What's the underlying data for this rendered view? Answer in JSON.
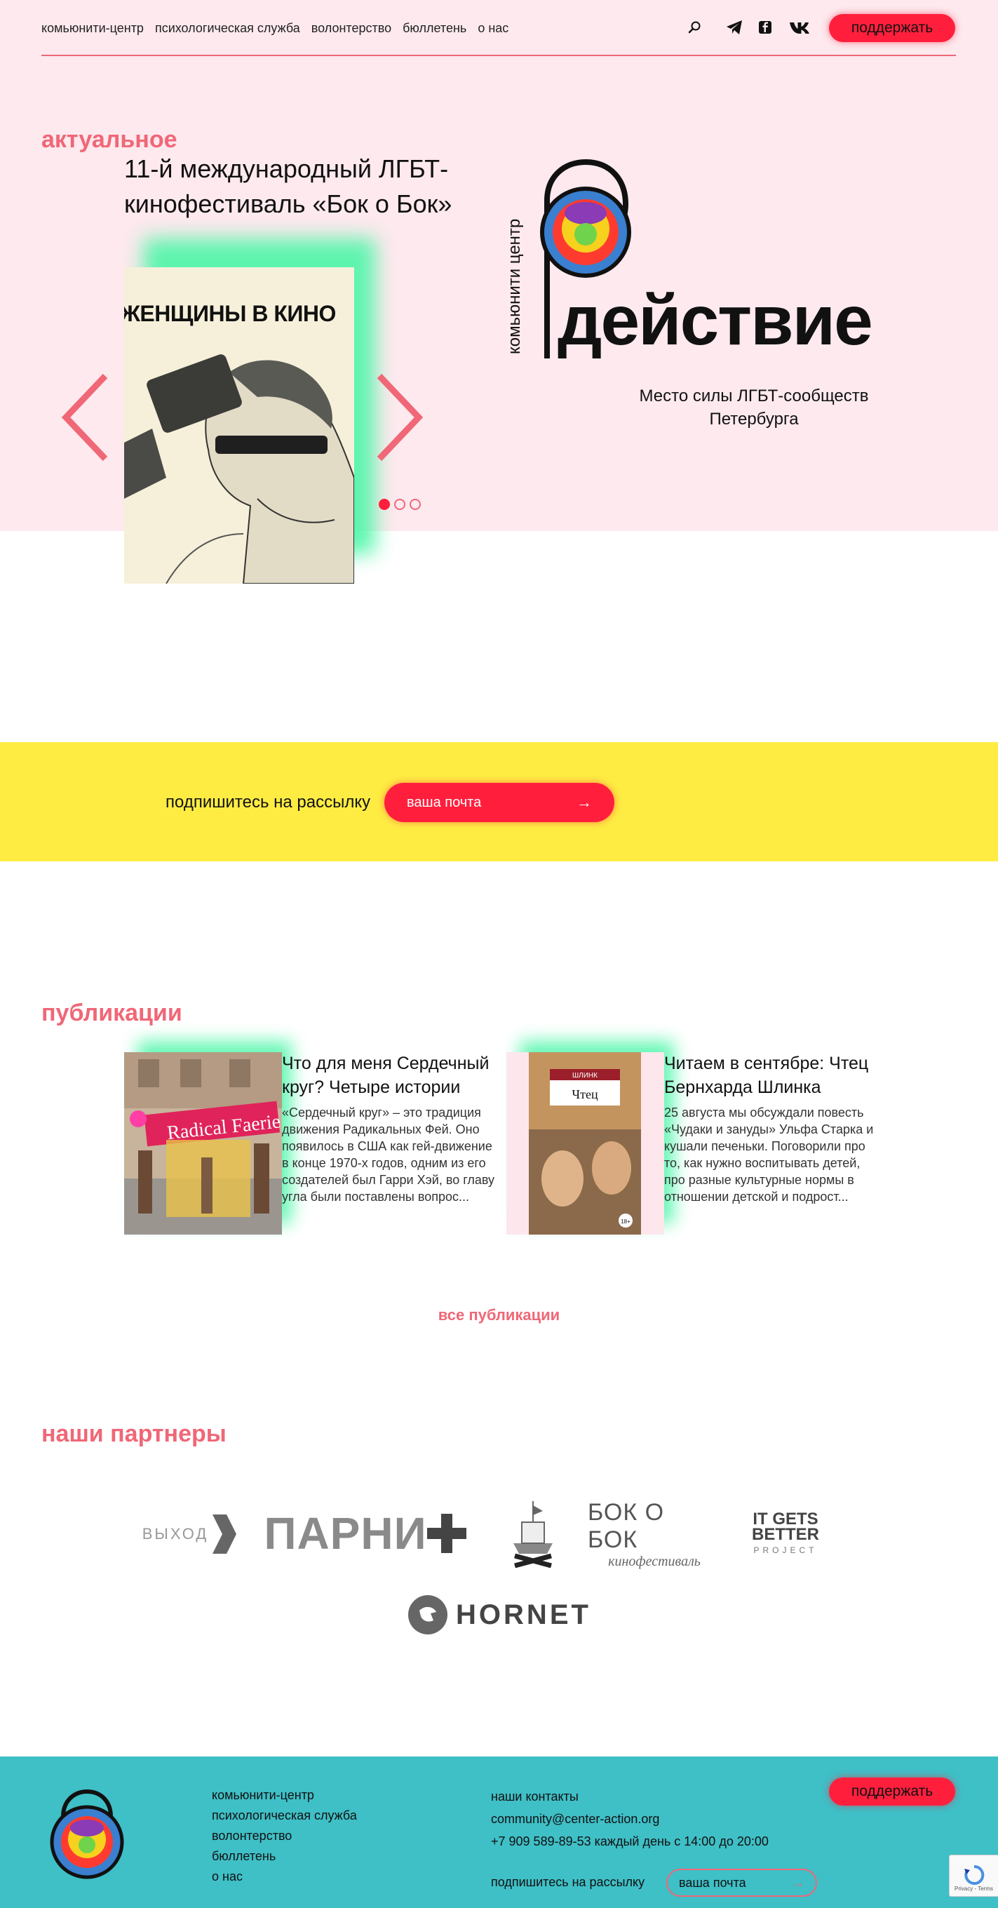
{
  "header": {
    "nav": [
      "комьюнити-центр",
      "психологическая служба",
      "волонтерство",
      "бюллетень",
      "о нас"
    ],
    "icons": [
      "search-icon",
      "telegram-icon",
      "facebook-icon",
      "vk-icon"
    ],
    "support_label": "поддержать"
  },
  "news": {
    "section_title": "актуальное",
    "slide_title": "11-й международный ЛГБТ-кинофестиваль «Бок о Бок»",
    "slide_image_caption": "ЖЕНЩИНЫ В КИНО",
    "dots_count": 3,
    "active_dot": 1
  },
  "logo": {
    "vertical_text": "комьюнити центр",
    "word": "действие",
    "tagline": "Место силы ЛГБТ-сообществ Петербурга"
  },
  "newsletter": {
    "label": "подпишитесь на рассылку",
    "placeholder": "ваша почта"
  },
  "publications": {
    "section_title": "публикации",
    "items": [
      {
        "title": "Что для меня Сердечный круг? Четыре истории",
        "excerpt": "«Сердечный круг» – это традиция движения Радикальных Фей. Оно появилось в США как гей-движение в конце 1970-х годов, одним из его создателей был Гарри Хэй, во главу угла были поставлены вопрос..."
      },
      {
        "title": "Читаем в сентябре: Чтец Бернхарда Шлинка",
        "excerpt": "25 августа мы обсуждали повесть «Чудаки и зануды» Ульфа Старка и кушали печеньки. Поговорили про то, как нужно воспитывать детей, про разные культурные нормы в отношении детской и подрост..."
      }
    ],
    "pub1_banner": "Radical Faerie",
    "pub2_book_author": "ШЛИНК",
    "pub2_book_title": "Чтец",
    "pub2_age": "18+",
    "all_label": "все публикации"
  },
  "partners": {
    "section_title": "наши партнеры",
    "vykhod": "ВЫХОД",
    "parni": "ПАРНИ",
    "bok_line1": "БОК О БОК",
    "bok_line2": "кинофестиваль",
    "igb_line1": "IT GETS",
    "igb_line2": "BETTER",
    "igb_line3": "PROJECT",
    "hornet": "HORNET"
  },
  "footer": {
    "nav": [
      "комьюнити-центр",
      "психологическая служба",
      "волонтерство",
      "бюллетень",
      "о нас"
    ],
    "contacts_title": "наши контакты",
    "email": "community@center-action.org",
    "phone": "+7 909 589-89-53 каждый день с 14:00 до 20:00",
    "newsletter_label": "подпишитесь на рассылку",
    "newsletter_placeholder": "ваша почта",
    "support_label": "поддержать",
    "recaptcha_text": "Privacy - Terms"
  },
  "colors": {
    "pink_bg": "#fde9ee",
    "accent_red": "#ff1f3d",
    "title_pink": "#f06777",
    "mint_glow": "#4cf6a8",
    "yellow_band": "#feec43",
    "footer_teal": "#3fbfc6"
  }
}
